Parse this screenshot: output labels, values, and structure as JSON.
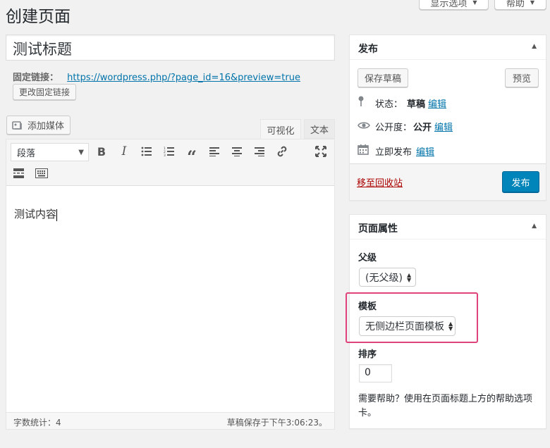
{
  "header": {
    "title": "创建页面",
    "screen_options": "显示选项",
    "help": "帮助"
  },
  "editor": {
    "post_title": "测试标题",
    "permalink_label": "固定链接：",
    "permalink_url": "https://wordpress.php/?page_id=16&preview=true",
    "change_permalink": "更改固定链接",
    "add_media": "添加媒体",
    "tab_visual": "可视化",
    "tab_text": "文本",
    "format_select": "段落",
    "content": "测试内容",
    "word_count": "字数统计：4",
    "draft_saved": "草稿保存于下午3:06:23。"
  },
  "publish": {
    "title": "发布",
    "save_draft": "保存草稿",
    "preview": "预览",
    "status_label": "状态：",
    "status_value": "草稿",
    "visibility_label": "公开度：",
    "visibility_value": "公开",
    "schedule_label": "立即发布",
    "edit": "编辑",
    "trash": "移至回收站",
    "publish_button": "发布"
  },
  "page_attributes": {
    "title": "页面属性",
    "parent_label": "父级",
    "parent_value": "(无父级)",
    "template_label": "模板",
    "template_value": "无侧边栏页面模板",
    "order_label": "排序",
    "order_value": "0",
    "help_text": "需要帮助？使用在页面标题上方的帮助选项卡。"
  },
  "colors": {
    "primary": "#0085ba",
    "link": "#0073aa",
    "trash": "#a00",
    "highlight": "#e0427b"
  }
}
